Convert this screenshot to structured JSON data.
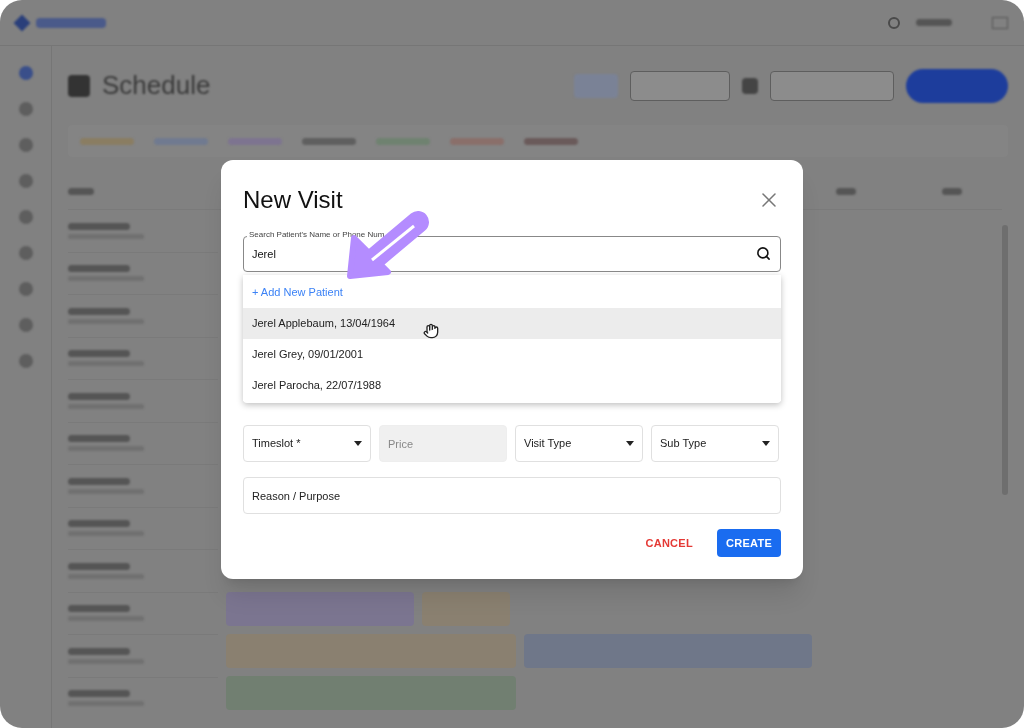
{
  "app": {
    "page_title": "Schedule",
    "view_toggle": {
      "selected": true
    }
  },
  "dialog": {
    "title": "New Visit",
    "search": {
      "label": "Search Patient's Name or Phone Num",
      "value": "Jerel"
    },
    "suggestions": [
      {
        "kind": "add",
        "label": "+ Add New Patient",
        "selected": false
      },
      {
        "kind": "patient",
        "label": "Jerel Applebaum, 13/04/1964",
        "selected": true
      },
      {
        "kind": "patient",
        "label": "Jerel Grey, 09/01/2001",
        "selected": false
      },
      {
        "kind": "patient",
        "label": "Jerel Parocha, 22/07/1988",
        "selected": false
      }
    ],
    "fields": [
      {
        "kind": "select",
        "label": "Timeslot *",
        "disabled": false
      },
      {
        "kind": "input",
        "placeholder": "Price",
        "disabled": true
      },
      {
        "kind": "select",
        "label": "Visit Type",
        "disabled": false
      },
      {
        "kind": "select",
        "label": "Sub Type",
        "disabled": false
      }
    ],
    "reason": {
      "placeholder": "Reason / Purpose"
    },
    "buttons": [
      {
        "kind": "text",
        "label": "CANCEL"
      },
      {
        "kind": "primary",
        "label": "CREATE"
      }
    ]
  }
}
